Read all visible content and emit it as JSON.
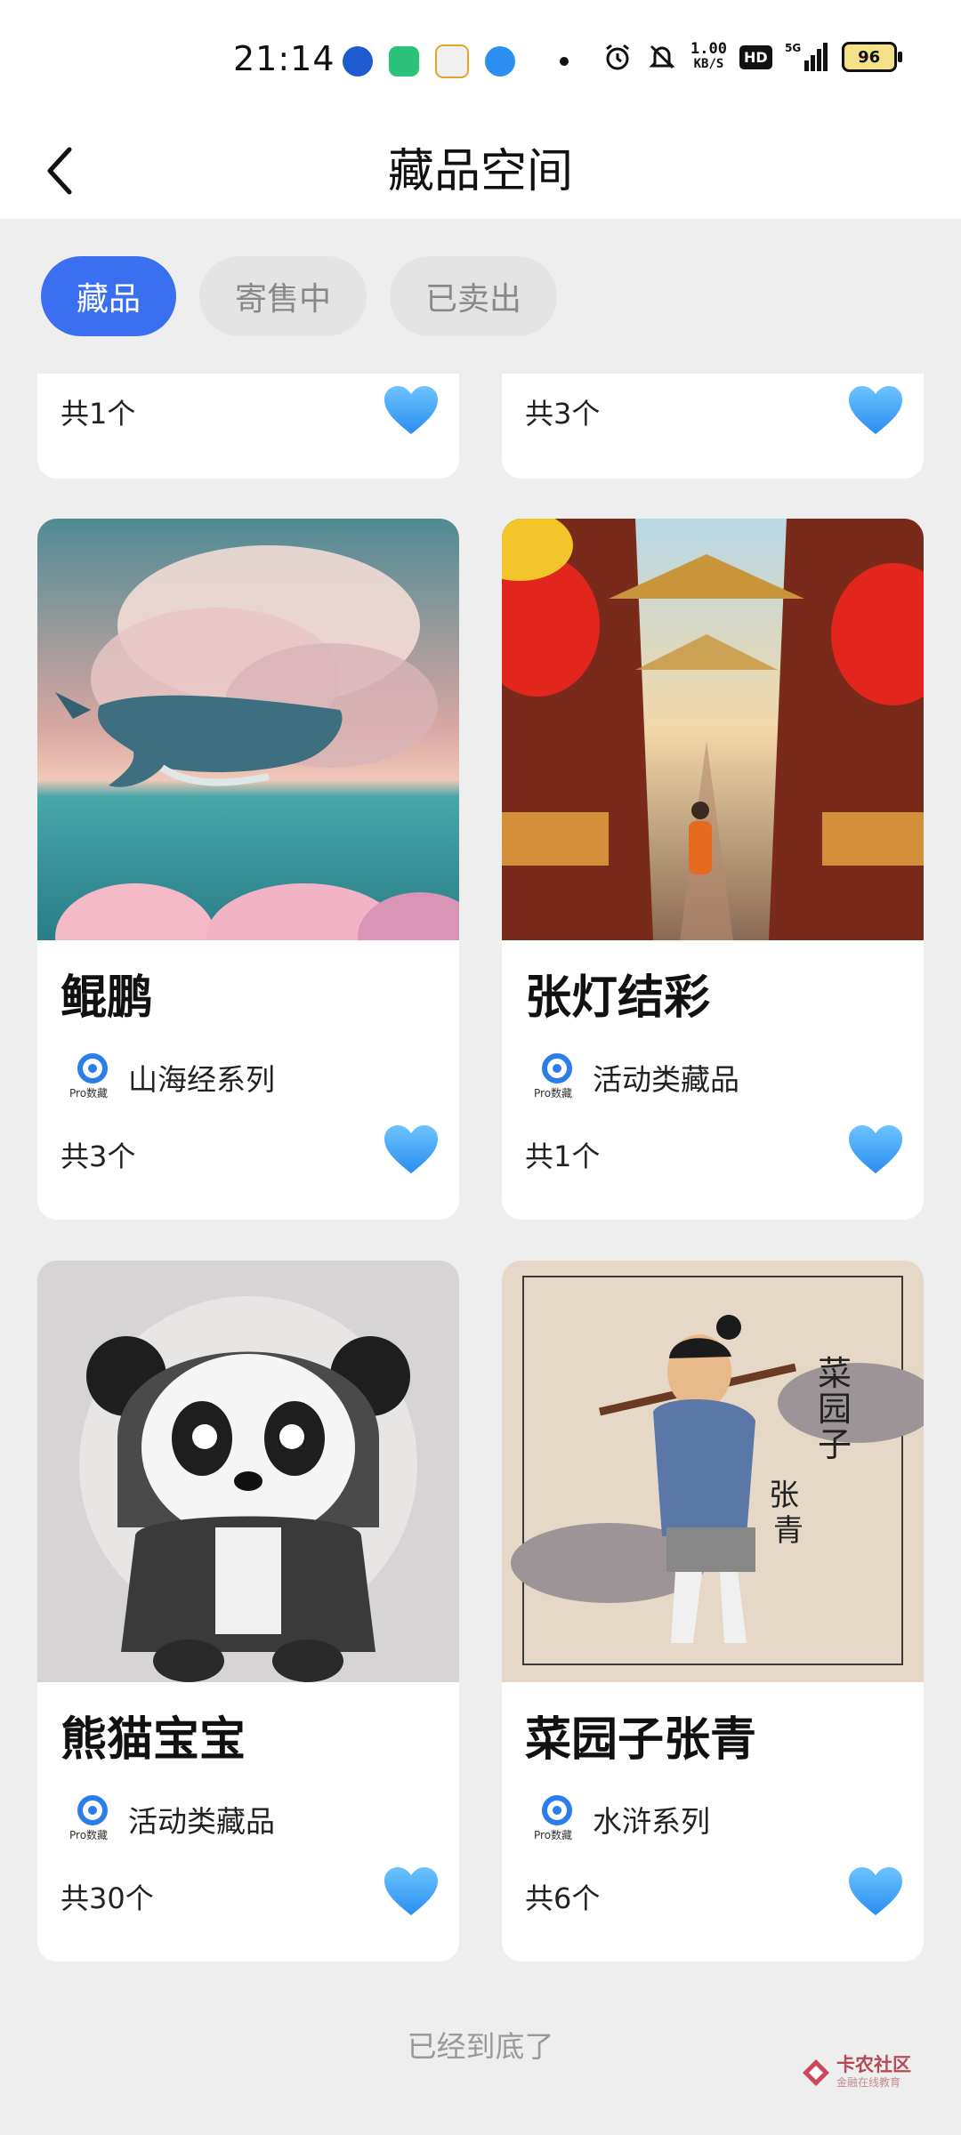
{
  "status_bar": {
    "time": "21:14",
    "net_speed_value": "1.00",
    "net_speed_unit": "KB/S",
    "hd_label": "HD",
    "signal_label": "5G",
    "battery": "96",
    "app_icons": [
      "bank-icon",
      "shop-icon",
      "mall-icon",
      "browser-icon"
    ]
  },
  "header": {
    "title": "藏品空间"
  },
  "tabs": [
    {
      "label": "藏品",
      "active": true
    },
    {
      "label": "寄售中",
      "active": false
    },
    {
      "label": "已卖出",
      "active": false
    }
  ],
  "partial_cards": [
    {
      "count": "共1个"
    },
    {
      "count": "共3个"
    }
  ],
  "cards": [
    {
      "title": "鲲鹏",
      "series": "山海经系列",
      "count": "共3个",
      "image": "whale-cloud-artwork"
    },
    {
      "title": "张灯结彩",
      "series": "活动类藏品",
      "count": "共1个",
      "image": "lantern-street-artwork"
    },
    {
      "title": "熊猫宝宝",
      "series": "活动类藏品",
      "count": "共30个",
      "image": "panda-hoodie-artwork"
    },
    {
      "title": "菜园子张青",
      "series": "水浒系列",
      "count": "共6个",
      "image": "farmer-zhangqing-artwork"
    }
  ],
  "brand": {
    "name": "Pro数藏"
  },
  "footer": {
    "end_text": "已经到底了"
  },
  "watermark": {
    "name": "卡农社区",
    "tagline": "金融在线教育"
  },
  "colors": {
    "accent": "#3b6ff2",
    "heart": "#3aa4f5",
    "background": "#eeeeee"
  }
}
